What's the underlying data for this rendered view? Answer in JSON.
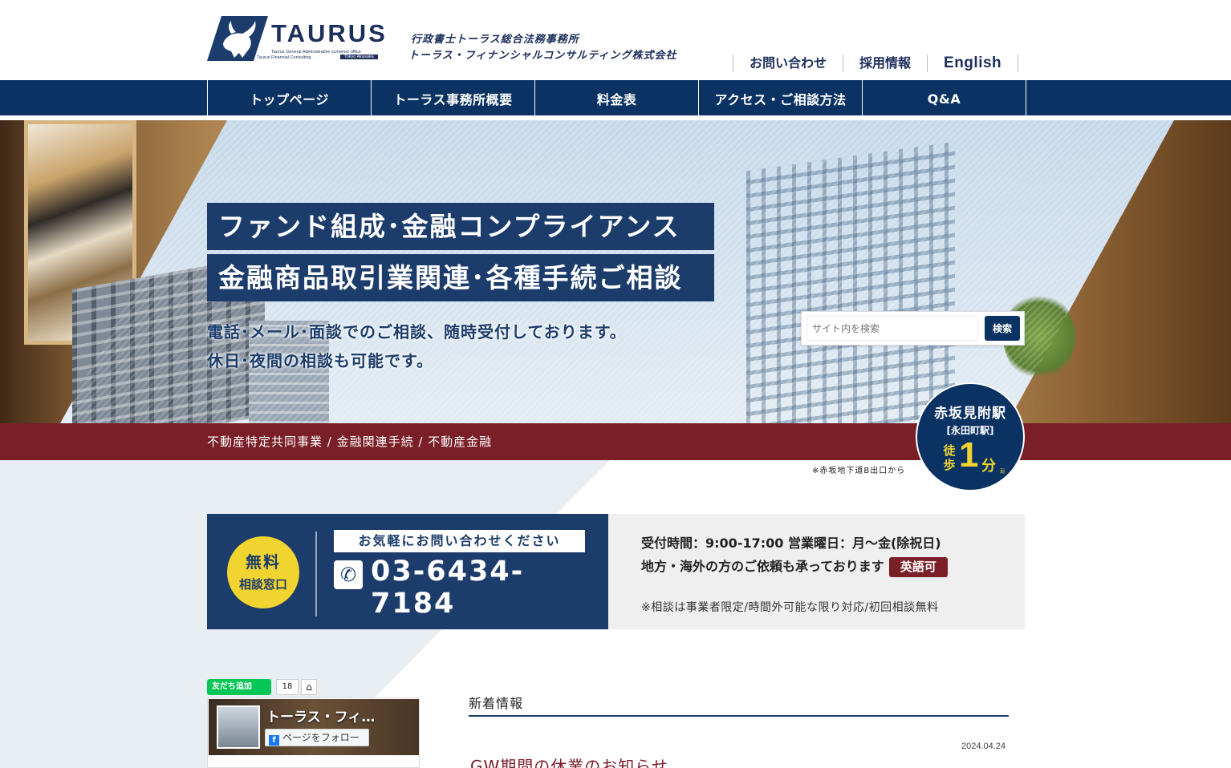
{
  "header": {
    "logo_word": "TAURUS",
    "logo_line1": "Taurus General Administrative scrivener office",
    "logo_line2": "Taurus Financial Consulting",
    "logo_tag": "Tokyo Akasaka",
    "company_line1": "行政書士トーラス総合法務事務所",
    "company_line2": "トーラス・フィナンシャルコンサルティング株式会社",
    "links": [
      "お問い合わせ",
      "採用情報",
      "English"
    ]
  },
  "nav": {
    "items": [
      "トップページ",
      "トーラス事務所概要",
      "料金表",
      "アクセス・ご相談方法",
      "Q&A"
    ]
  },
  "hero": {
    "headline1": "ファンド組成･金融コンプライアンス",
    "headline2": "金融商品取引業関連･各種手続ご相談",
    "text1": "電話･メール･面談でのご相談、随時受付しております。",
    "text2": "休日･夜間の相談も可能です。",
    "search_placeholder": "サイト内を検索",
    "search_button": "検索"
  },
  "band": {
    "text": "不動産特定共同事業 / 金融関連手続 / 不動産金融"
  },
  "station": {
    "name": "赤坂見附駅",
    "sub": "[永田町駅]",
    "walk": "徒歩",
    "minutes": "1",
    "unit": "分",
    "unit_small": "弱",
    "note": "※赤坂地下道B出口から"
  },
  "contact": {
    "free_line1": "無料",
    "free_line2": "相談窓口",
    "lead": "お気軽にお問い合わせください",
    "phone_icon": "phone-icon",
    "phone": "03-6434-7184",
    "hours": "受付時間：9:00-17:00 営業曜日：月〜金(除祝日)",
    "overseas": "地方・海外の方のご依頼も承っております",
    "english_badge": "英語可",
    "note": "※相談は事業者限定/時間外可能な限り対応/初回相談無料"
  },
  "sidebar": {
    "line_button": "友だち追加",
    "line_count": "18",
    "home_icon": "home-icon",
    "fb_title": "トーラス・フィ…",
    "fb_follow": "ページをフォロー",
    "fb_icon": "f"
  },
  "news": {
    "heading": "新着情報",
    "items": [
      {
        "date": "2024.04.24",
        "title": "GW期間の休業のお知らせ"
      }
    ]
  },
  "colors": {
    "navy": "#0a3263",
    "navy_dark": "#1c3c6b",
    "burgundy": "#7a1e27",
    "yellow": "#f1d430",
    "line_green": "#06c755"
  }
}
